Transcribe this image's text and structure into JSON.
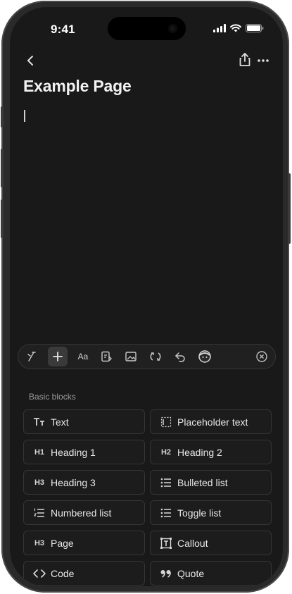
{
  "status_bar": {
    "time": "9:41"
  },
  "page": {
    "title": "Example Page"
  },
  "toolbar": {
    "text_style_label": "Aa"
  },
  "blocks_section": {
    "label": "Basic blocks",
    "items": [
      {
        "label": "Text",
        "icon_name": "text-icon",
        "icon_glyph": "Tт"
      },
      {
        "label": "Placeholder text",
        "icon_name": "placeholder-icon",
        "icon_glyph": ""
      },
      {
        "label": "Heading 1",
        "icon_name": "heading1-icon",
        "icon_glyph": "H1"
      },
      {
        "label": "Heading 2",
        "icon_name": "heading2-icon",
        "icon_glyph": "H2"
      },
      {
        "label": "Heading 3",
        "icon_name": "heading3-icon",
        "icon_glyph": "H3"
      },
      {
        "label": "Bulleted list",
        "icon_name": "bulleted-list-icon",
        "icon_glyph": ""
      },
      {
        "label": "Numbered list",
        "icon_name": "numbered-list-icon",
        "icon_glyph": ""
      },
      {
        "label": "Toggle list",
        "icon_name": "toggle-list-icon",
        "icon_glyph": ""
      },
      {
        "label": "Page",
        "icon_name": "page-icon",
        "icon_glyph": "H3"
      },
      {
        "label": "Callout",
        "icon_name": "callout-icon",
        "icon_glyph": ""
      },
      {
        "label": "Code",
        "icon_name": "code-icon",
        "icon_glyph": "<>"
      },
      {
        "label": "Quote",
        "icon_name": "quote-icon",
        "icon_glyph": "99"
      }
    ]
  },
  "colors": {
    "background": "#191919",
    "text": "#f2f2f2",
    "muted": "#9b9b9b",
    "block_border": "#353535"
  }
}
